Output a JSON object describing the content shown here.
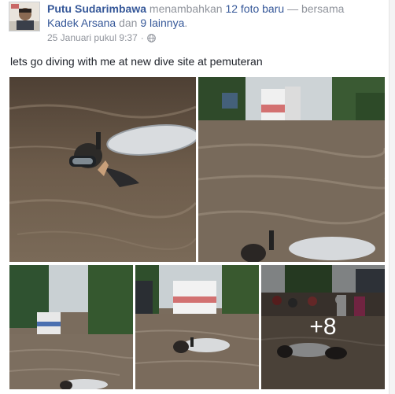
{
  "post": {
    "author": "Putu Sudarimbawa",
    "action_text": "menambahkan",
    "photo_count_link": "12 foto baru",
    "with_text": "— bersama",
    "tagged_person": "Kadek Arsana",
    "and_text": "dan",
    "others_link": "9 lainnya",
    "period": ".",
    "timestamp": "25 Januari pukul 9:37",
    "separator": "·",
    "privacy_icon": "globe-icon",
    "caption": "lets go diving with me at new dive site at pemuteran"
  },
  "photos": {
    "more_count": "+8"
  },
  "colors": {
    "link": "#365899",
    "muted": "#90949c",
    "text": "#1d2129"
  }
}
